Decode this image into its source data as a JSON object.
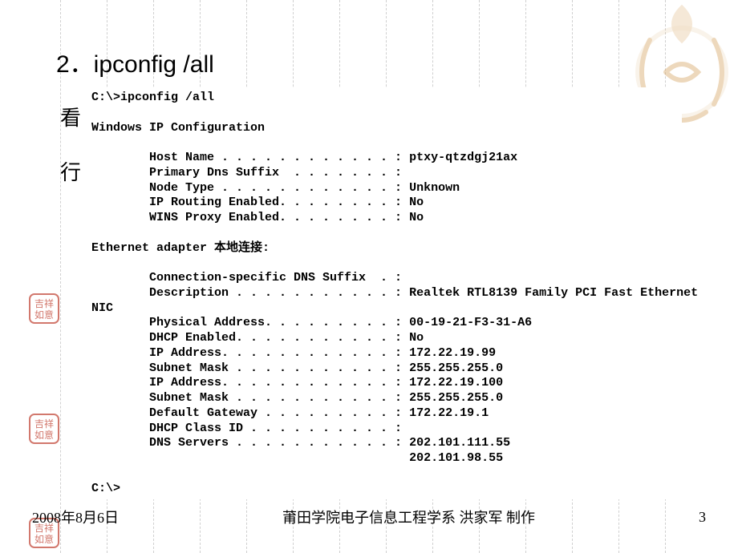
{
  "title": "2．ipconfig /all",
  "backgroundText": {
    "line1": "看",
    "line2": "行"
  },
  "terminal": {
    "promptCmd": "C:\\>ipconfig /all",
    "blank1": "",
    "header": "Windows IP Configuration",
    "blank2": "",
    "hostName": "        Host Name . . . . . . . . . . . . : ptxy-qtzdgj21ax",
    "primaryDns": "        Primary Dns Suffix  . . . . . . . :",
    "nodeType": "        Node Type . . . . . . . . . . . . : Unknown",
    "ipRouting": "        IP Routing Enabled. . . . . . . . : No",
    "winsProxy": "        WINS Proxy Enabled. . . . . . . . : No",
    "blank3": "",
    "adapterHeader": "Ethernet adapter 本地连接:",
    "blank4": "",
    "connSuffix": "        Connection-specific DNS Suffix  . :",
    "description": "        Description . . . . . . . . . . . : Realtek RTL8139 Family PCI Fast Ethernet",
    "nic": "NIC",
    "physAddr": "        Physical Address. . . . . . . . . : 00-19-21-F3-31-A6",
    "dhcpEnabled": "        DHCP Enabled. . . . . . . . . . . : No",
    "ipAddr1": "        IP Address. . . . . . . . . . . . : 172.22.19.99",
    "subnet1": "        Subnet Mask . . . . . . . . . . . : 255.255.255.0",
    "ipAddr2": "        IP Address. . . . . . . . . . . . : 172.22.19.100",
    "subnet2": "        Subnet Mask . . . . . . . . . . . : 255.255.255.0",
    "gateway": "        Default Gateway . . . . . . . . . : 172.22.19.1",
    "dhcpClass": "        DHCP Class ID . . . . . . . . . . :",
    "dns1": "        DNS Servers . . . . . . . . . . . : 202.101.111.55",
    "dns2": "                                            202.101.98.55",
    "blank5": "",
    "promptEnd": "C:\\>"
  },
  "footer": {
    "date": "2008年8月6日",
    "center": "莆田学院电子信息工程学系 洪家军 制作",
    "page": "3"
  },
  "ornamentColor": "#d4a05a",
  "stampColor": "#c04030"
}
